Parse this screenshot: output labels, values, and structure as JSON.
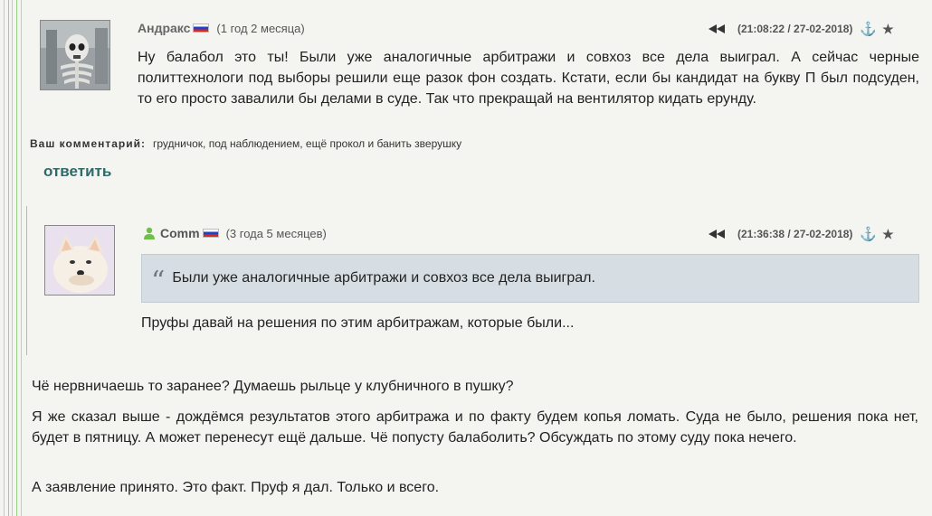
{
  "comment1": {
    "author": "Андракс",
    "tenure": "(1 год 2 месяца)",
    "timestamp": "(21:08:22 / 27-02-2018)",
    "text": "Ну балабол это ты! Были уже аналогичные арбитражи и совхоз все дела выиграл.  А сейчас черные политтехнологи под выборы решили еще разок фон создать. Кстати, если бы кандидат на букву П был подсуден, то его просто завалили бы делами в суде. Так что прекращай на вентилятор кидать ерунду.",
    "comment_label": "Ваш комментарий:",
    "comment_value": "грудничок, под наблюдением, ещё прокол и банить зверушку",
    "reply": "ответить"
  },
  "comment2": {
    "author": "Comm",
    "tenure": "(3 года 5 месяцев)",
    "timestamp": "(21:36:38 / 27-02-2018)",
    "quote": "Были уже аналогичные арбитражи и совхоз все дела выиграл.",
    "text": "Пруфы давай на решения по этим арбитражам, которые были..."
  },
  "reply_text": {
    "p1": "Чё нервничаешь то заранее? Думаешь рыльце у клубничного в пушку?",
    "p2": "Я же сказал выше - дождёмся результатов этого арбитража и по факту будем копья ломать. Суда не было, решения пока нет, будет в пятницу. А может перенесут ещё дальше. Чё попусту балаболить? Обсуждать по этому суду пока нечего.",
    "p3": "А заявление принято. Это факт. Пруф я дал. Только и всего."
  },
  "colors": {
    "thread_line_green": "#9bd08a",
    "thread_line_gray": "#c8c8c8",
    "quote_bg": "#d6dee3",
    "reply_link": "#2e6a6a"
  },
  "icons": [
    "flag-ru-icon",
    "rewind-icon",
    "anchor-icon",
    "star-icon",
    "user-online-icon",
    "quote-icon"
  ]
}
